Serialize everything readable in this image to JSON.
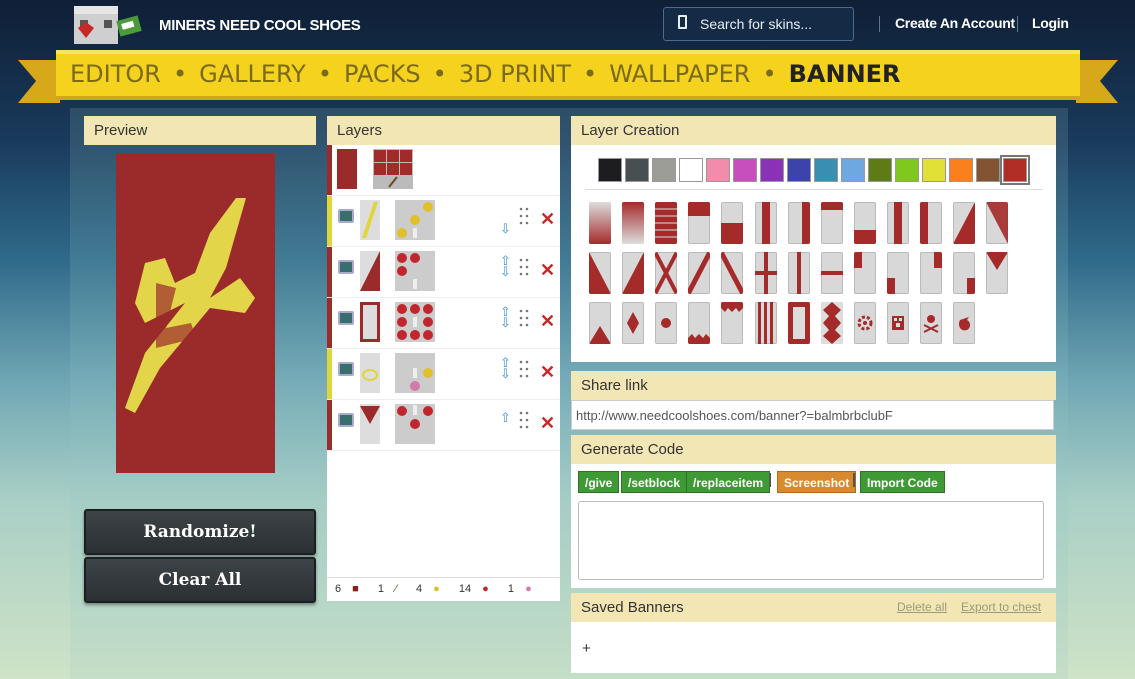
{
  "header": {
    "site_name": "MINERS NEED COOL SHOES",
    "search_placeholder": "Search for skins...",
    "create_account": "Create An Account",
    "login": "Login"
  },
  "nav": {
    "items": [
      "EDITOR",
      "GALLERY",
      "PACKS",
      "3D PRINT",
      "WALLPAPER",
      "BANNER"
    ],
    "active": "BANNER"
  },
  "preview": {
    "title": "Preview",
    "randomize_label": "Randomize!",
    "clear_label": "Clear All"
  },
  "layers": {
    "title": "Layers",
    "rows": [
      {
        "color": "#9b2b2b",
        "strip": "#9b2b2b"
      },
      {
        "color": "#e0d53a",
        "strip": "#e0d53a"
      },
      {
        "color": "#9b2b2b",
        "strip": "#9b2b2b"
      },
      {
        "color": "#9b2b2b",
        "strip": "#9b2b2b"
      },
      {
        "color": "#e0d53a",
        "strip": "#e0d53a"
      },
      {
        "color": "#9b2b2b",
        "strip": "#9b2b2b"
      }
    ],
    "footer": [
      {
        "count": "6",
        "icon": "red-wool-icon"
      },
      {
        "count": "1",
        "icon": "stick-icon"
      },
      {
        "count": "4",
        "icon": "yellow-dye-icon"
      },
      {
        "count": "14",
        "icon": "red-dye-icon"
      },
      {
        "count": "1",
        "icon": "pink-item-icon"
      }
    ]
  },
  "creation": {
    "title": "Layer Creation",
    "colors": [
      "#1d1d21",
      "#474f52",
      "#9d9d97",
      "#ffffff",
      "#f38baa",
      "#c74ebd",
      "#8932b8",
      "#3c44aa",
      "#3a8eb0",
      "#6fa7e0",
      "#5e7c16",
      "#80c71f",
      "#e0e036",
      "#f9801d",
      "#835432",
      "#b02e26"
    ]
  },
  "share": {
    "title": "Share link",
    "url": "http://www.needcoolshoes.com/banner?=balmbrbclubF"
  },
  "generate": {
    "title": "Generate Code",
    "give": "/give",
    "setblock": "/setblock",
    "replaceitem": "/replaceitem",
    "screenshot": "Screenshot",
    "import": "Import Code"
  },
  "saved": {
    "title": "Saved Banners",
    "delete_all": "Delete all",
    "export": "Export to chest",
    "add": "+"
  }
}
